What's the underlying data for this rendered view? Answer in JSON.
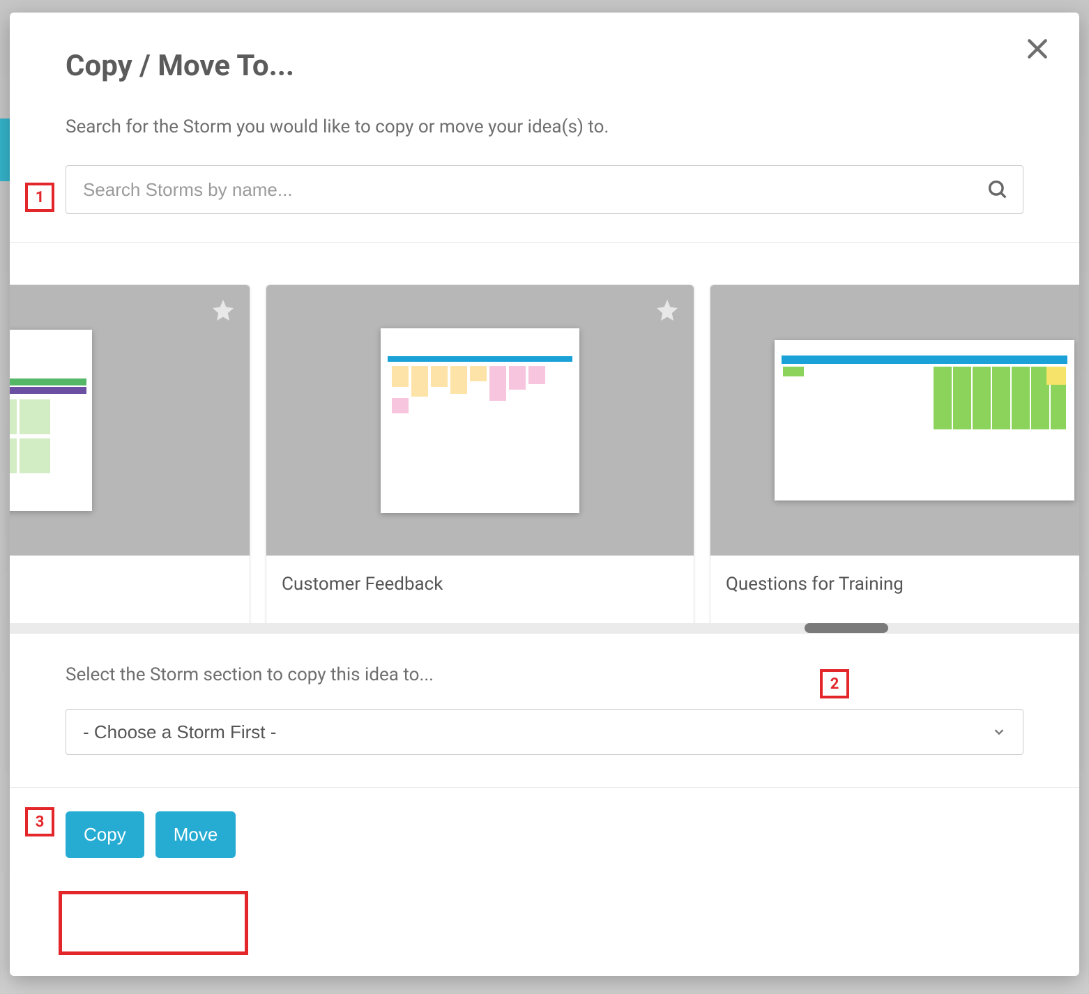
{
  "dialog": {
    "title": "Copy / Move To...",
    "subtitle": "Search for the Storm you would like to copy or move your idea(s) to.",
    "section_prompt": "Select the Storm section to copy this idea to..."
  },
  "search": {
    "placeholder": "Search Storms by name..."
  },
  "storms": [
    {
      "title": ""
    },
    {
      "title": "Customer Feedback"
    },
    {
      "title": "Questions for Training"
    },
    {
      "title": ""
    }
  ],
  "select": {
    "placeholder": "- Choose a Storm First -"
  },
  "buttons": {
    "copy": "Copy",
    "move": "Move"
  },
  "annotations": {
    "n1": "1",
    "n2": "2",
    "n3": "3"
  }
}
